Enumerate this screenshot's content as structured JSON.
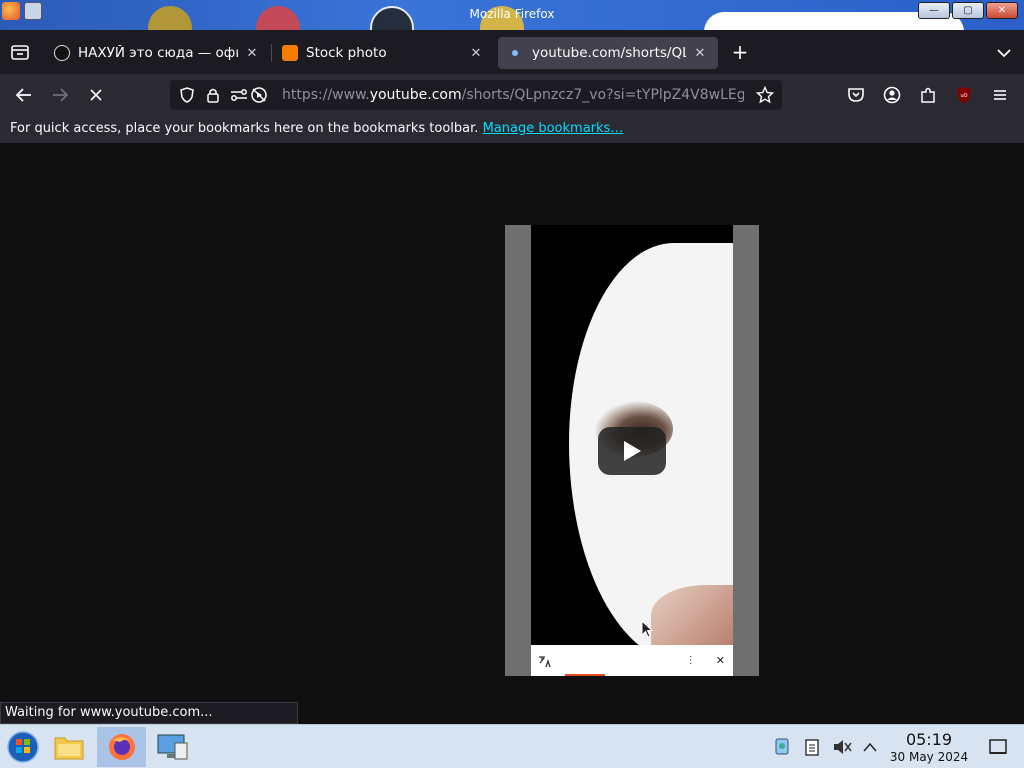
{
  "window": {
    "title": "Mozilla Firefox",
    "buttons": {
      "minimize": "—",
      "maximize": "▢",
      "close": "✕"
    }
  },
  "tabs": [
    {
      "label": "НАХУЙ это сюда — офи",
      "favicon": "tiktok-icon",
      "close": "✕",
      "active": false
    },
    {
      "label": "Stock photo",
      "favicon": "blogger-icon",
      "close": "✕",
      "active": false
    },
    {
      "label": "youtube.com/shorts/QLpnz",
      "favicon": "loading-dot-icon",
      "close": "✕",
      "active": true
    }
  ],
  "new_tab": "+",
  "urlbar": {
    "prefix": "https://www.",
    "host": "youtube.com",
    "path": "/shorts/QLpnzcz7_vo?si=tYPlpZ4V8wLEg"
  },
  "bookmarks_bar": {
    "message": "For quick access, place your bookmarks here on the bookmarks toolbar.",
    "link": "Manage bookmarks…"
  },
  "video": {
    "ad_label": "",
    "ad_text": "",
    "more": "⋮",
    "close": "✕"
  },
  "status_text": "Waiting for www.youtube.com...",
  "taskbar": {
    "time": "05:19",
    "date": "30 May 2024"
  },
  "colors": {
    "accent_link": "#00ddff",
    "tab_active_bg": "#42414d",
    "toolbar_bg": "#2b2a33",
    "page_bg": "#0f0f0f"
  }
}
